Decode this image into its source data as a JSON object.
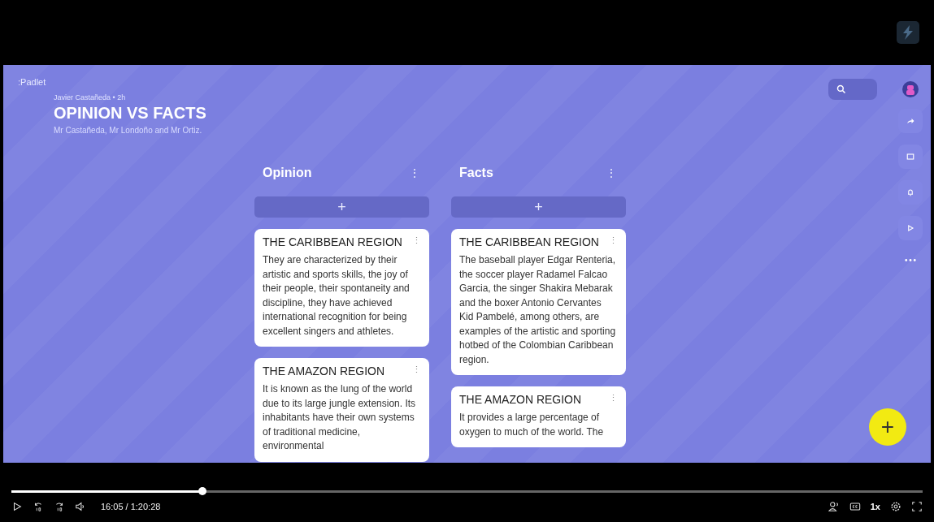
{
  "player": {
    "time": "16:05 / 1:20:28",
    "speed": "1x",
    "level": 0.21
  },
  "board": {
    "logo": ":Padlet",
    "author": "Javier Castañeda • 2h",
    "title": "OPINION VS FACTS",
    "subtitle": "Mr Castañeda, Mr Londoño and Mr Ortiz.",
    "columns": [
      {
        "title": "Opinion",
        "menu": "⋮",
        "add": "+",
        "cards": [
          {
            "title": "THE CARIBBEAN REGION",
            "menu": "⋮",
            "body": "They are characterized by their artistic and sports skills, the joy of their people, their spontaneity and discipline, they have achieved international recognition for being excellent singers and athletes."
          },
          {
            "title": "THE AMAZON REGION",
            "menu": "⋮",
            "body": "It is known as the lung of the world due to its large jungle extension. Its inhabitants have their own systems of traditional medicine, environmental"
          }
        ]
      },
      {
        "title": "Facts",
        "menu": "⋮",
        "add": "+",
        "cards": [
          {
            "title": "THE CARIBBEAN REGION",
            "menu": "⋮",
            "body": "The baseball player Edgar Renteria, the soccer player Radamel Falcao Garcia, the singer Shakira Mebarak and the boxer Antonio Cervantes Kid Pambelé, among others, are examples of the artistic and sporting hotbed of the Colombian Caribbean region."
          },
          {
            "title": "THE AMAZON REGION",
            "menu": "⋮",
            "body": "It provides a large percentage of oxygen to much of the world.  The"
          }
        ]
      }
    ],
    "fab": "+"
  }
}
